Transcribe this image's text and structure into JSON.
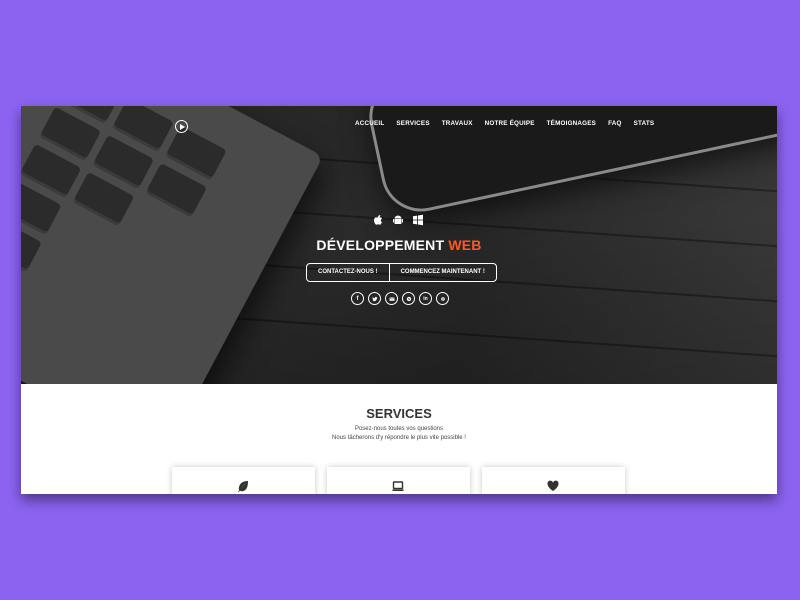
{
  "nav": {
    "items": [
      "ACCUEIL",
      "SERVICES",
      "TRAVAUX",
      "NOTRE ÉQUIPE",
      "TÉMOIGNAGES",
      "FAQ",
      "STATS"
    ]
  },
  "hero": {
    "platform_icons": [
      "apple-icon",
      "android-icon",
      "windows-icon"
    ],
    "title_main": "DÉVELOPPEMENT",
    "title_accent": "WEB",
    "accent_color": "#ff5a1f",
    "buttons": {
      "contact": "CONTACTEZ-NOUS !",
      "start": "COMMENCEZ MAINTENANT !"
    },
    "socials": [
      "facebook-icon",
      "twitter-icon",
      "email-icon",
      "skype-icon",
      "linkedin-icon",
      "settings-icon"
    ]
  },
  "services": {
    "title": "SERVICES",
    "subtitle_line1": "Posez-nous toutes vos questions",
    "subtitle_line2": "Nous tâcherons d'y répondre le plus vite possible !",
    "cards": [
      {
        "icon": "leaf-icon"
      },
      {
        "icon": "laptop-icon"
      },
      {
        "icon": "heart-icon"
      }
    ]
  },
  "colors": {
    "background": "#8b63f0",
    "accent": "#ff5a1f"
  }
}
